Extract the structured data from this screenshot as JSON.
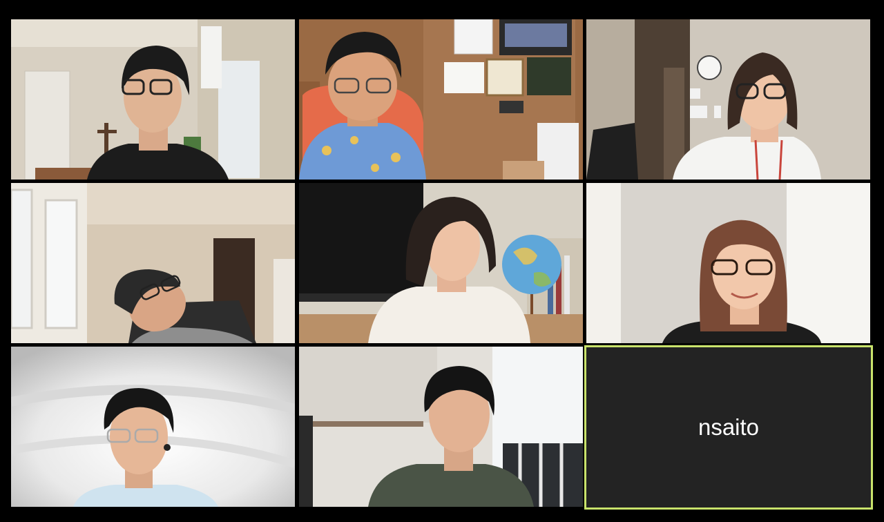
{
  "meeting": {
    "participants": [
      {
        "id": "p1",
        "kind": "video"
      },
      {
        "id": "p2",
        "kind": "video"
      },
      {
        "id": "p3",
        "kind": "video"
      },
      {
        "id": "p4",
        "kind": "video"
      },
      {
        "id": "p5",
        "kind": "video"
      },
      {
        "id": "p6",
        "kind": "video"
      },
      {
        "id": "p7",
        "kind": "video"
      },
      {
        "id": "p8",
        "kind": "video"
      },
      {
        "id": "p9",
        "kind": "no-video",
        "name": "nsaito",
        "active_speaker": true
      }
    ]
  },
  "colors": {
    "background": "#000000",
    "active_speaker_border": "#c9e36b",
    "empty_tile": "#232323",
    "name_text": "#ffffff"
  }
}
